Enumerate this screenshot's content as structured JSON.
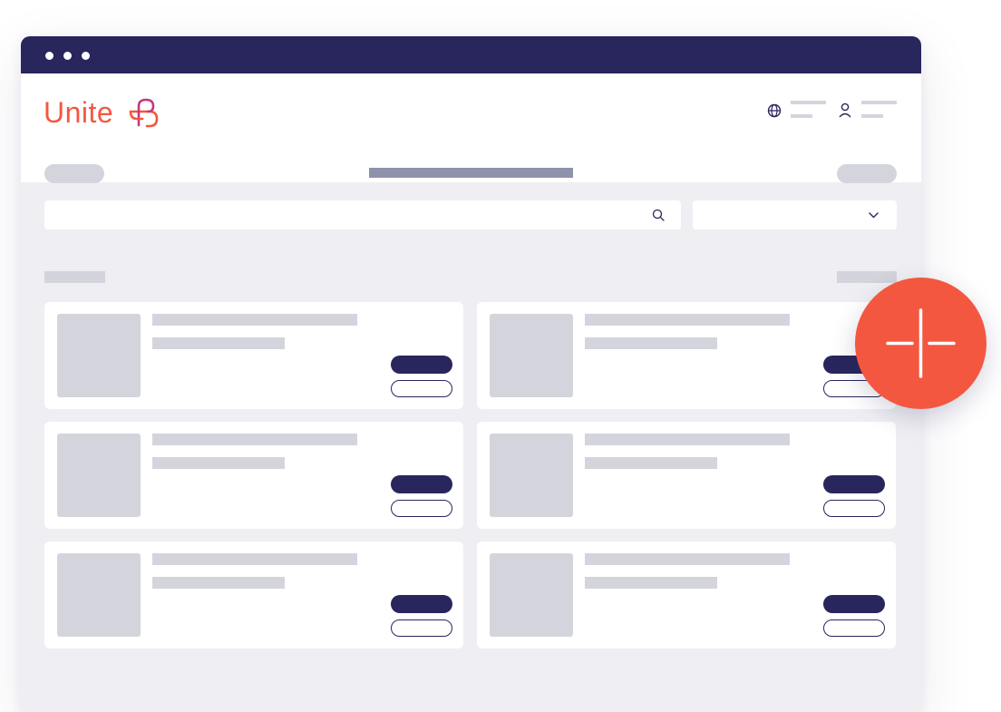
{
  "window": {
    "titlebar_color": "#29255d",
    "controls": [
      "window-dot",
      "window-dot",
      "window-dot"
    ]
  },
  "header": {
    "logo_text": "Unite",
    "logo_color": "#f4573f",
    "language_icon": "globe-icon",
    "account_icon": "user-icon"
  },
  "toolbar": {
    "search_icon": "search-icon",
    "select_icon": "chevron-down-icon"
  },
  "cards": [
    {
      "id": 1
    },
    {
      "id": 2
    },
    {
      "id": 3
    },
    {
      "id": 4
    },
    {
      "id": 5
    },
    {
      "id": 6
    }
  ],
  "fab": {
    "icon": "plus-icon",
    "color": "#f4573f"
  },
  "colors": {
    "accent": "#f4573f",
    "navy": "#29255d",
    "placeholder": "#d4d4dc",
    "canvas": "#efeff3"
  }
}
